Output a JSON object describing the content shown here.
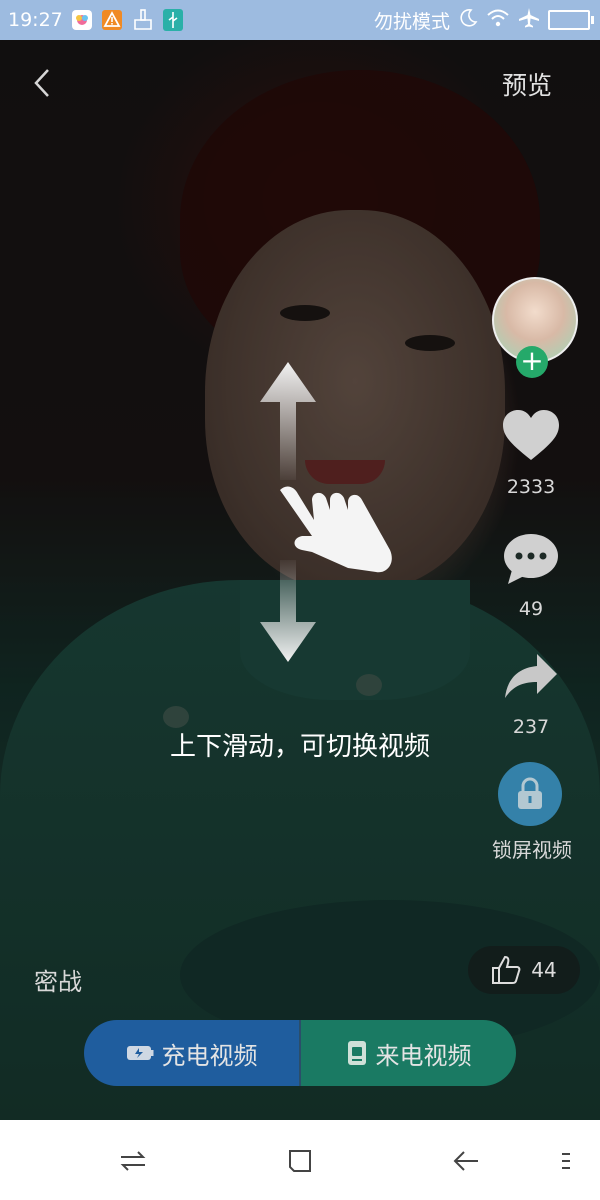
{
  "status_bar": {
    "time": "19:27",
    "dnd_label": "勿扰模式",
    "icons": [
      "photos-app-icon",
      "warning-icon",
      "broom-icon",
      "usb-icon",
      "moon-icon",
      "wifi-icon",
      "airplane-icon",
      "battery-icon"
    ]
  },
  "top_bar": {
    "back_icon": "chevron-left-icon",
    "preview_label": "预览"
  },
  "side_actions": {
    "follow_icon": "plus-icon",
    "like_count": "2333",
    "comment_count": "49",
    "share_count": "237",
    "lock_screen_label": "锁屏视频"
  },
  "gesture_hint": {
    "text": "上下滑动，可切换视频"
  },
  "video_info": {
    "title": "密战",
    "thumbs_up_count": "44"
  },
  "bottom_actions": {
    "charge_video_label": "充电视频",
    "incoming_call_video_label": "来电视频"
  },
  "nav_bar": {
    "icons": [
      "switch-apps-icon",
      "home-square-icon",
      "back-arrow-icon",
      "menu-icon"
    ]
  },
  "colors": {
    "status_bar_bg": "#9dbbe0",
    "follow_green": "#25a96a",
    "charge_blue": "#1f5d9e",
    "call_green": "#1a7a63",
    "lock_blue": "#3a8fc0"
  }
}
